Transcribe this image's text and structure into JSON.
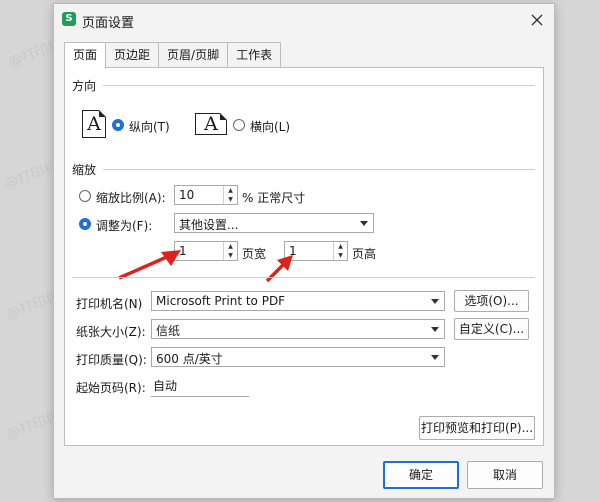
{
  "window": {
    "title": "页面设置",
    "app_icon_letter": "S"
  },
  "tabs": [
    {
      "label": "页面",
      "active": true
    },
    {
      "label": "页边距",
      "active": false
    },
    {
      "label": "页眉/页脚",
      "active": false
    },
    {
      "label": "工作表",
      "active": false
    }
  ],
  "orientation": {
    "heading": "方向",
    "portrait_label": "纵向(T)",
    "landscape_label": "横向(L)",
    "icon_letter": "A",
    "selected": "portrait"
  },
  "scaling": {
    "heading": "缩放",
    "adjust_label": "缩放比例(A):",
    "adjust_value": "10",
    "adjust_suffix": "% 正常尺寸",
    "fit_label": "调整为(F):",
    "fit_select": "其他设置...",
    "pages_wide_value": "1",
    "pages_wide_label": "页宽",
    "pages_tall_value": "1",
    "pages_tall_label": "页高",
    "selected": "fit"
  },
  "printer": {
    "name_label": "打印机名(N)",
    "name_value": "Microsoft Print to PDF",
    "options_button": "选项(O)...",
    "paper_label": "纸张大小(Z):",
    "paper_value": "信纸",
    "custom_button": "自定义(C)...",
    "quality_label": "打印质量(Q):",
    "quality_value": "600 点/英寸",
    "first_page_label": "起始页码(R):",
    "first_page_value": "自动"
  },
  "buttons": {
    "preview_print": "打印预览和打印(P)...",
    "ok": "确定",
    "cancel": "取消"
  },
  "watermark": "@打印机卫士",
  "colors": {
    "accent": "#1d6fd8",
    "annotation_arrow": "#e0201a"
  }
}
